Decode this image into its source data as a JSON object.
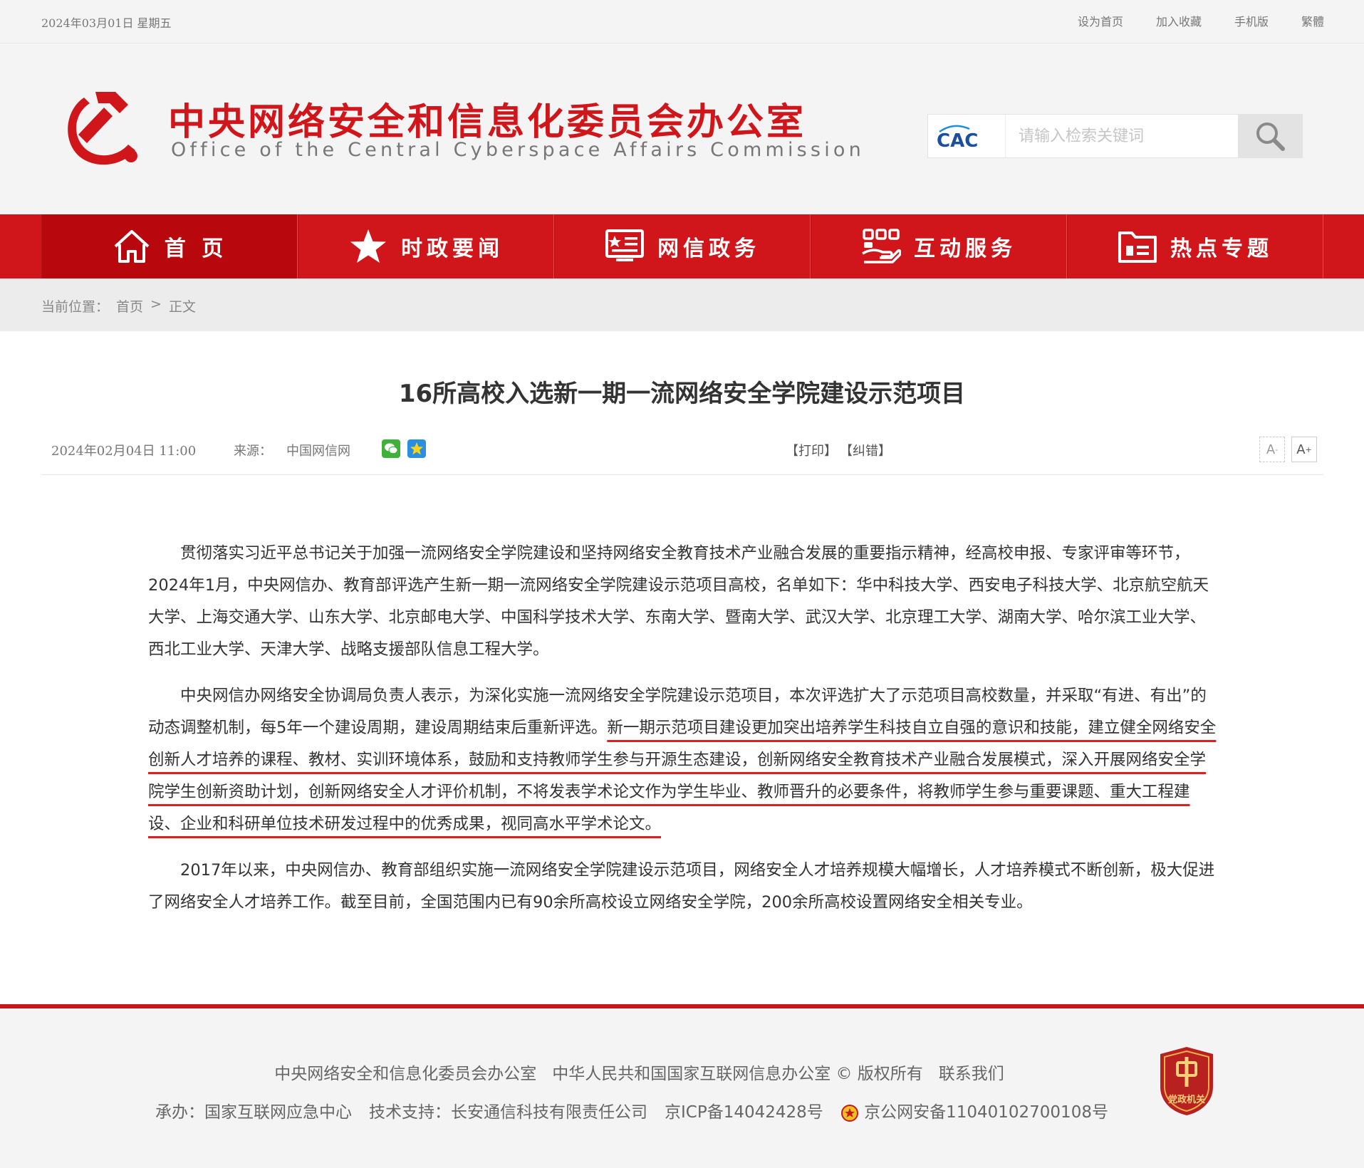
{
  "topbar": {
    "date": "2024年03月01日 星期五",
    "links": [
      "设为首页",
      "加入收藏",
      "手机版",
      "繁體"
    ]
  },
  "header": {
    "title": "中央网络安全和信息化委员会办公室",
    "subtitle": "Office of the Central Cyberspace Affairs Commission",
    "search_logo_text": "CAC",
    "search_placeholder": "请输入检索关键词"
  },
  "nav": {
    "items": [
      {
        "label": "首 页",
        "icon": "home-icon",
        "active": true
      },
      {
        "label": "时政要闻",
        "icon": "star-icon",
        "active": false
      },
      {
        "label": "网信政务",
        "icon": "bulletin-icon",
        "active": false
      },
      {
        "label": "互动服务",
        "icon": "hand-service-icon",
        "active": false
      },
      {
        "label": "热点专题",
        "icon": "folder-icon",
        "active": false
      }
    ]
  },
  "breadcrumb": {
    "prefix": "当前位置：",
    "home": "首页",
    "sep": ">",
    "current": "正文"
  },
  "article": {
    "title": "16所高校入选新一期一流网络安全学院建设示范项目",
    "time": "2024年02月04日 11:00",
    "source_label": "来源：",
    "source": "中国网信网",
    "print": "【打印】",
    "correct": "【纠错】",
    "font_small": "A",
    "font_large": "A",
    "p1": "贯彻落实习近平总书记关于加强一流网络安全学院建设和坚持网络安全教育技术产业融合发展的重要指示精神，经高校申报、专家评审等环节，2024年1月，中央网信办、教育部评选产生新一期一流网络安全学院建设示范项目高校，名单如下：华中科技大学、西安电子科技大学、北京航空航天大学、上海交通大学、山东大学、北京邮电大学、中国科学技术大学、东南大学、暨南大学、武汉大学、北京理工大学、湖南大学、哈尔滨工业大学、西北工业大学、天津大学、战略支援部队信息工程大学。",
    "p2_plain": "中央网信办网络安全协调局负责人表示，为深化实施一流网络安全学院建设示范项目，本次评选扩大了示范项目高校数量，并采取“有进、有出”的动态调整机制，每5年一个建设周期，建设周期结束后重新评选。",
    "p2_highlight": "新一期示范项目建设更加突出培养学生科技自立自强的意识和技能，建立健全网络安全创新人才培养的课程、教材、实训环境体系，鼓励和支持教师学生参与开源生态建设，创新网络安全教育技术产业融合发展模式，深入开展网络安全学院学生创新资助计划，创新网络安全人才评价机制，不将发表学术论文作为学生毕业、教师晋升的必要条件，将教师学生参与重要课题、重大工程建设、企业和科研单位技术研发过程中的优秀成果，视同高水平学术论文。",
    "p3": "2017年以来，中央网信办、教育部组织实施一流网络安全学院建设示范项目，网络安全人才培养规模大幅增长，人才培养模式不断创新，极大促进了网络安全人才培养工作。截至目前，全国范围内已有90余所高校设立网络安全学院，200余所高校设置网络安全相关专业。"
  },
  "footer": {
    "org1": "中央网络安全和信息化委员会办公室",
    "org2": "中华人民共和国国家互联网信息办公室",
    "copyright": "© 版权所有",
    "contact": "联系我们",
    "host": "承办：国家互联网应急中心",
    "tech": "技术支持：长安通信科技有限责任公司",
    "icp": "京ICP备14042428号",
    "police": "京公网安备11040102700108号",
    "badge_text": "党政机关"
  },
  "colors": {
    "brand_red": "#d1161b",
    "nav_active": "#b8080d",
    "underline_red": "#e02020"
  }
}
